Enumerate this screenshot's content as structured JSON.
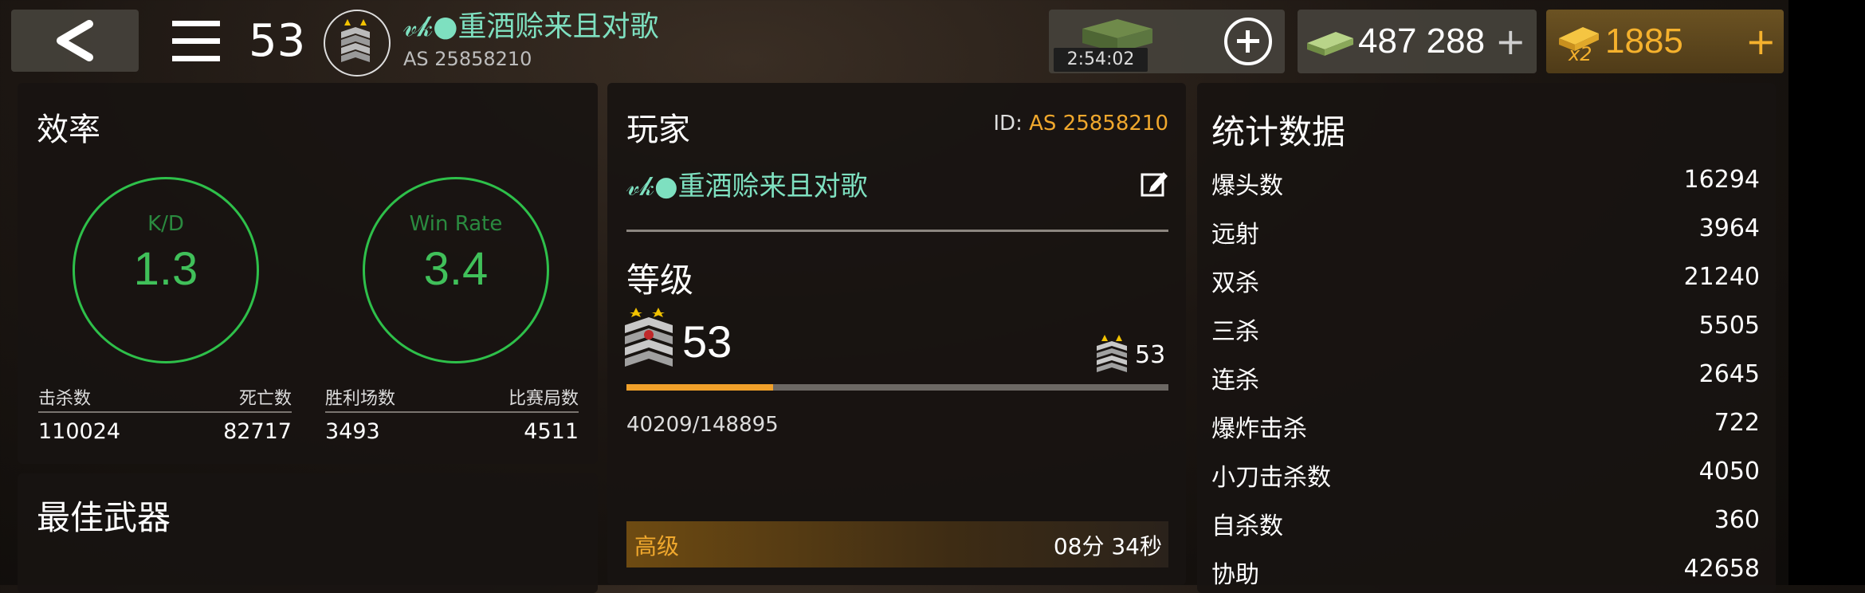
{
  "topbar": {
    "level": "53",
    "player_name": "𝓋𝓀●重酒赊来且对歌",
    "player_id": "AS 25858210",
    "crate_timer": "2:54:02",
    "cash": "487 288",
    "gold": "1885",
    "gold_multiplier": "x2",
    "plus": "+"
  },
  "efficiency": {
    "title": "效率",
    "kd_label": "K/D",
    "kd_value": "1.3",
    "winrate_label": "Win Rate",
    "winrate_value": "3.4",
    "kills_label": "击杀数",
    "kills": "110024",
    "deaths_label": "死亡数",
    "deaths": "82717",
    "wins_label": "胜利场数",
    "wins": "3493",
    "matches_label": "比赛局数",
    "matches": "4511"
  },
  "best_weapon": {
    "title": "最佳武器"
  },
  "player": {
    "title": "玩家",
    "id_label": "ID:",
    "id_value": "AS 25858210",
    "name": "𝓋𝓀●重酒赊来且对歌",
    "grade_title": "等级",
    "level": "53",
    "next_level": "53",
    "xp_text": "40209/148895",
    "xp_progress": 0.27,
    "advanced_label": "高级",
    "advanced_time": "08分 34秒"
  },
  "stats": {
    "title": "统计数据",
    "rows": [
      {
        "label": "爆头数",
        "value": "16294"
      },
      {
        "label": "远射",
        "value": "3964"
      },
      {
        "label": "双杀",
        "value": "21240"
      },
      {
        "label": "三杀",
        "value": "5505"
      },
      {
        "label": "连杀",
        "value": "2645"
      },
      {
        "label": "爆炸击杀",
        "value": "722"
      },
      {
        "label": "小刀击杀数",
        "value": "4050"
      },
      {
        "label": "自杀数",
        "value": "360"
      },
      {
        "label": "协助",
        "value": "42658"
      }
    ]
  },
  "colors": {
    "accent_green": "#40c05a",
    "accent_orange": "#f0a82d",
    "name_teal": "#7ee0c0"
  }
}
